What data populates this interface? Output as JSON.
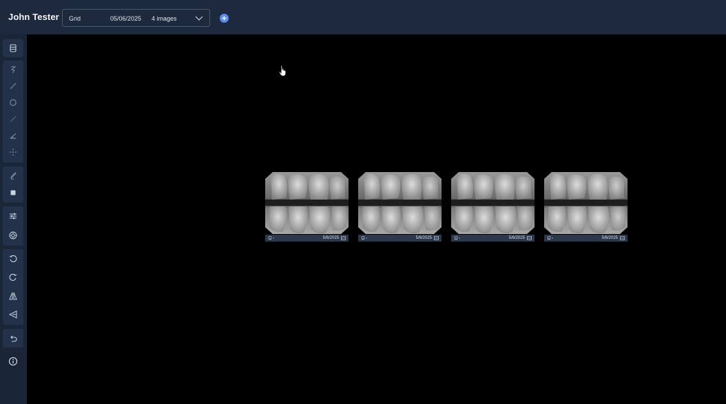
{
  "header": {
    "user_name": "John Tester",
    "selector": {
      "mode": "Grid",
      "date": "05/06/2025",
      "count": "4 images"
    },
    "accent_color": "#5b8df0"
  },
  "sidebar": {
    "tools": [
      "layers-icon",
      "lasso-icon",
      "line-icon",
      "circle-icon",
      "ruler-icon",
      "angle-icon",
      "move-icon",
      "marker-icon",
      "square-icon",
      "sliders-icon",
      "filter-icon",
      "rotate-left-icon",
      "rotate-right-icon",
      "flip-horizontal-icon",
      "flip-vertical-icon",
      "undo-icon",
      "info-icon"
    ]
  },
  "images": [
    {
      "date": "5/6/2025"
    },
    {
      "date": "5/6/2025"
    },
    {
      "date": "5/6/2025"
    },
    {
      "date": "5/6/2025"
    }
  ]
}
